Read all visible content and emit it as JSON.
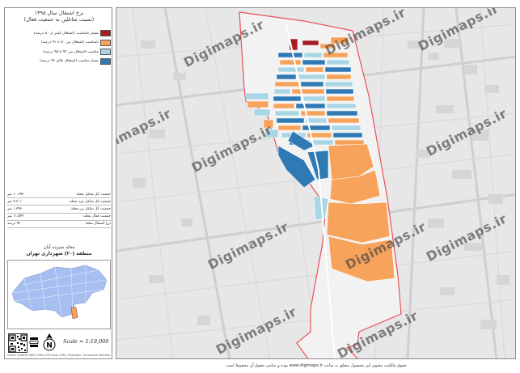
{
  "title": {
    "line1": "نرخ اشتغال سال ۱۳۹۵",
    "line2": "(نسبت شاغلین به جمعیت فعال)"
  },
  "legend": [
    {
      "label": "بسیار نامناسب (اشتغال کمتر از ۸۰ درصد)",
      "color": "#a61c24"
    },
    {
      "label": "نامناسب (اشتغال بین ۸۰ تا ۹۱ درصد)",
      "color": "#f7a35c"
    },
    {
      "label": "مناسب (اشتغال بین ۹۲ تا ۹۵ درصد)",
      "color": "#a9d6e5"
    },
    {
      "label": "بسیار مناسب (اشتغال بالای ۹۶ درصد)",
      "color": "#2f79b5"
    }
  ],
  "stats": [
    {
      "label": "جمعیت کل شاغل محله:",
      "value": "۱۰,۶۹۶ نفر"
    },
    {
      "label": "جمعیت کل شاغل مرد محله:",
      "value": "۹,۳۰۱ نفر"
    },
    {
      "label": "جمعیت کل شاغل زن محله:",
      "value": "۱,۳۹۶ نفر"
    },
    {
      "label": "جمعیت فعال محله:",
      "value": "۱۱,۵۴۲ نفر"
    },
    {
      "label": "نرخ اشتغال محله:",
      "value": "۹۳ درصد"
    }
  ],
  "district": {
    "line1": "محله سیزده آبان",
    "line2": "منطقه (۲۰) شهرداری تهران"
  },
  "scale": "Scale = 1:19,000",
  "north_label": "N",
  "sidebar_footer": "Coord. System: WGS 1984 UTM Zone 39N | Projection: Transverse Mercator",
  "footer_note": "حقوق مالکیت معنوی این محصول متعلق به سایت www.digimaps.ir بوده و تمامی حقوق آن محفوظ است.",
  "watermark": "Digimaps.ir",
  "icons": {
    "north": "north-arrow-icon",
    "scale": "scale-bar-icon",
    "qr": "qr-code-icon"
  },
  "colors": {
    "very_poor": "#a61c24",
    "poor": "#f7a35c",
    "good": "#a9d6e5",
    "very_good": "#2f79b5",
    "boundary": "#e8515a",
    "basemap": "#e7e7e7",
    "inset_city": "#a7bff0",
    "inset_highlight": "#f7a35c"
  }
}
